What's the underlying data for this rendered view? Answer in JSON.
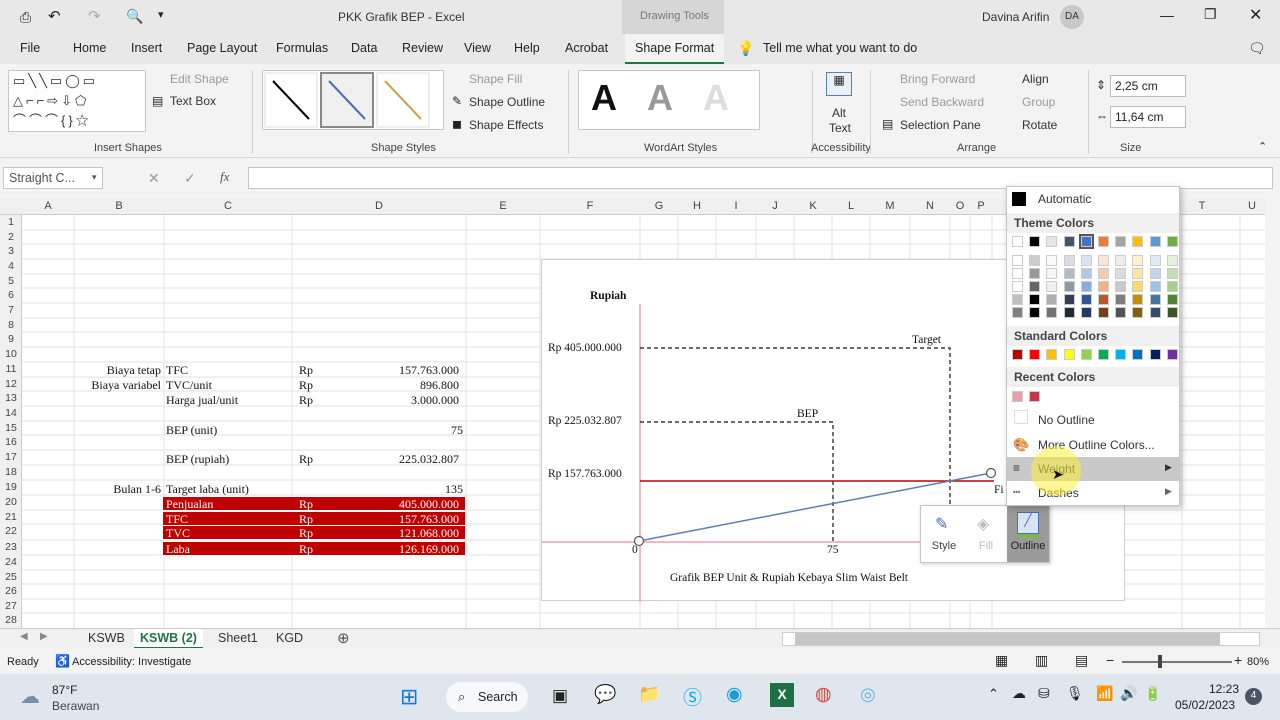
{
  "window": {
    "title": "PKK Grafik BEP  -  Excel",
    "context_tab_group": "Drawing Tools",
    "user_name": "Davina Arifin",
    "user_initials": "DA"
  },
  "menu_tabs": [
    "File",
    "Home",
    "Insert",
    "Page Layout",
    "Formulas",
    "Data",
    "Review",
    "View",
    "Help",
    "Acrobat",
    "Shape Format"
  ],
  "tell_me": "Tell me what you want to do",
  "ribbon": {
    "insert_shapes": {
      "label": "Insert Shapes",
      "edit_shape": "Edit Shape",
      "text_box": "Text Box"
    },
    "shape_styles": {
      "label": "Shape Styles",
      "fill": "Shape Fill",
      "outline": "Shape Outline",
      "effects": "Shape Effects"
    },
    "wordart": {
      "label": "WordArt Styles",
      "sample": "A"
    },
    "accessibility": {
      "label": "Accessibility",
      "alt_text_1": "Alt",
      "alt_text_2": "Text"
    },
    "arrange": {
      "label": "Arrange",
      "bring_forward": "Bring Forward",
      "send_backward": "Send Backward",
      "selection_pane": "Selection Pane",
      "align": "Align",
      "group": "Group",
      "rotate": "Rotate"
    },
    "size": {
      "label": "Size",
      "height": "2,25 cm",
      "width": "11,64 cm"
    }
  },
  "name_box": "Straight C...",
  "fx_label": "fx",
  "columns": [
    "A",
    "B",
    "C",
    "D",
    "E",
    "F",
    "G",
    "H",
    "I",
    "J",
    "K",
    "L",
    "M",
    "N",
    "O",
    "P",
    "T",
    "U"
  ],
  "rows": [
    "1",
    "2",
    "3",
    "4",
    "5",
    "6",
    "7",
    "8",
    "9",
    "10",
    "11",
    "12",
    "13",
    "14",
    "15",
    "16",
    "17",
    "18",
    "19",
    "20",
    "21",
    "22",
    "23",
    "24",
    "25",
    "26",
    "27",
    "28"
  ],
  "table": {
    "r11": {
      "b": "Biaya tetap",
      "c": "TFC",
      "rp": "Rp",
      "d": "157.763.000"
    },
    "r12": {
      "b": "Biaya variabel",
      "c": "TVC/unit",
      "rp": "Rp",
      "d": "896.800"
    },
    "r13": {
      "c": "Harga jual/unit",
      "rp": "Rp",
      "d": "3.000.000"
    },
    "r15": {
      "c": "BEP (unit)",
      "d": "75"
    },
    "r17": {
      "c": "BEP (rupiah)",
      "rp": "Rp",
      "d": "225.032.807"
    },
    "r19": {
      "b": "Bulan 1-6",
      "c": "Target laba (unit)",
      "d": "135"
    },
    "r20": {
      "c": "Penjualan",
      "rp": "Rp",
      "d": "405.000.000"
    },
    "r21": {
      "c": "TFC",
      "rp": "Rp",
      "d": "157.763.000"
    },
    "r22": {
      "c": "TVC",
      "rp": "Rp",
      "d": "121.068.000"
    },
    "r23": {
      "c": "Laba",
      "rp": "Rp",
      "d": "126.169.000"
    }
  },
  "chart": {
    "y_title": "Rupiah",
    "y_labels": [
      "Rp  405.000.000",
      "Rp  225.032.807",
      "Rp  157.763.000"
    ],
    "x_labels": [
      "0",
      "75"
    ],
    "target_label": "Target",
    "bep_label": "BEP",
    "fi_label": "Fi",
    "caption": "Grafik BEP Unit & Rupiah Kebaya Slim Waist Belt",
    "colors": {
      "fixed_line": "#c00000",
      "cost_line": "#5b7fb3",
      "axis": "#e8a0b0"
    }
  },
  "popup": {
    "automatic": "Automatic",
    "theme_colors": "Theme Colors",
    "standard_colors": "Standard Colors",
    "recent_colors": "Recent Colors",
    "no_outline": "No Outline",
    "more_colors": "More Outline Colors...",
    "weight": "Weight",
    "dashes": "Dashes",
    "theme_top": [
      "#ffffff",
      "#000000",
      "#e7e6e6",
      "#44546a",
      "#4472c4",
      "#ed7d31",
      "#a5a5a5",
      "#ffc000",
      "#5b9bd5",
      "#70ad47"
    ],
    "standard": [
      "#c00000",
      "#ff0000",
      "#ffc000",
      "#ffff00",
      "#92d050",
      "#00b050",
      "#00b0f0",
      "#0070c0",
      "#002060",
      "#7030a0"
    ],
    "recent": [
      "#e8a0b0",
      "#c8364a"
    ]
  },
  "mini_toolbar": {
    "style": "Style",
    "fill": "Fill",
    "outline": "Outline"
  },
  "sheets": [
    "KSWB",
    "KSWB (2)",
    "Sheet1",
    "KGD"
  ],
  "status": {
    "ready": "Ready",
    "accessibility": "Accessibility: Investigate",
    "zoom": "80%"
  },
  "taskbar": {
    "temp": "87°F",
    "weather": "Berawan",
    "search": "Search",
    "time": "12:23",
    "date": "05/02/2023",
    "notif": "4"
  }
}
